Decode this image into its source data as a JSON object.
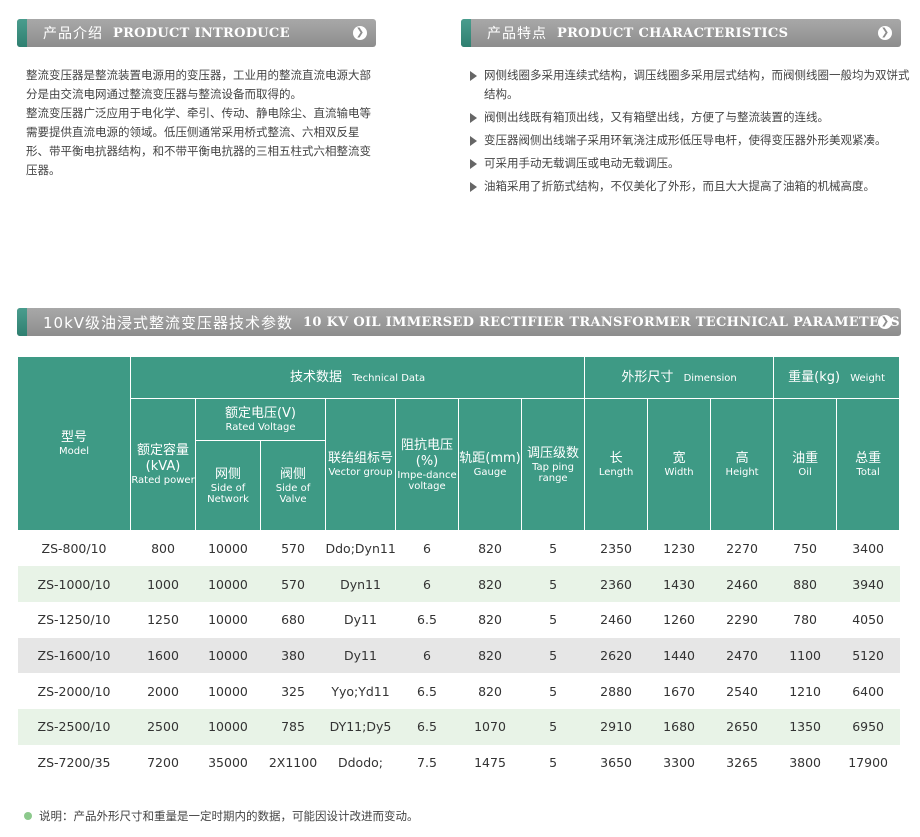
{
  "intro": {
    "header_cn": "产品介绍",
    "header_en": "PRODUCT INTRODUCE",
    "paragraphs": [
      "整流变压器是整流装置电源用的变压器，工业用的整流直流电源大部分是由交流电网通过整流变压器与整流设备而取得的。",
      "整流变压器广泛应用于电化学、牵引、传动、静电除尘、直流输电等需要提供直流电源的领域。低压侧通常采用桥式整流、六相双反星形、带平衡电抗器结构，和不带平衡电抗器的三相五柱式六相整流变压器。"
    ]
  },
  "features": {
    "header_cn": "产品特点",
    "header_en": "PRODUCT CHARACTERISTICS",
    "items": [
      "网侧线圈多采用连续式结构，调压线圈多采用层式结构，而阀侧线圈一般均为双饼式结构。",
      "阀侧出线既有箱顶出线，又有箱壁出线，方便了与整流装置的连线。",
      "变压器阀侧出线端子采用环氧浇注成形低压导电杆，使得变压器外形美观紧凑。",
      "可采用手动无载调压或电动无载调压。",
      "油箱采用了折筋式结构，不仅美化了外形，而且大大提高了油箱的机械高度。"
    ]
  },
  "params": {
    "header_cn": "10kV级油浸式整流变压器技术参数",
    "header_en": "10 KV OIL IMMERSED RECTIFIER TRANSFORMER TECHNICAL PARAMETERS",
    "groups": {
      "model_cn": "型号",
      "model_en": "Model",
      "tech_cn": "技术数据",
      "tech_en": "Technical Data",
      "dim_cn": "外形尺寸",
      "dim_en": "Dimension",
      "weight_cn": "重量(kg)",
      "weight_en": "Weight"
    },
    "columns": {
      "rated_power_cn": "额定容量(kVA)",
      "rated_power_en": "Rated power",
      "rated_voltage_cn": "额定电压(V)",
      "rated_voltage_en": "Rated Voltage",
      "network_cn": "网侧",
      "network_en": "Side of Network",
      "valve_cn": "阀侧",
      "valve_en": "Side of Valve",
      "vector_cn": "联结组标号",
      "vector_en": "Vector group",
      "impedance_cn": "阻抗电压(%)",
      "impedance_en": "Impe-dance voltage",
      "gauge_cn": "轨距(mm)",
      "gauge_en": "Gauge",
      "tap_cn": "调压级数",
      "tap_en": "Tap ping range",
      "length_cn": "长",
      "length_en": "Length",
      "width_cn": "宽",
      "width_en": "Width",
      "height_cn": "高",
      "height_en": "Height",
      "oil_cn": "油重",
      "oil_en": "Oil",
      "total_cn": "总重",
      "total_en": "Total"
    },
    "rows": [
      [
        "ZS-800/10",
        "800",
        "10000",
        "570",
        "Ddo;Dyn11",
        "6",
        "820",
        "5",
        "2350",
        "1230",
        "2270",
        "750",
        "3400"
      ],
      [
        "ZS-1000/10",
        "1000",
        "10000",
        "570",
        "Dyn11",
        "6",
        "820",
        "5",
        "2360",
        "1430",
        "2460",
        "880",
        "3940"
      ],
      [
        "ZS-1250/10",
        "1250",
        "10000",
        "680",
        "Dy11",
        "6.5",
        "820",
        "5",
        "2460",
        "1260",
        "2290",
        "780",
        "4050"
      ],
      [
        "ZS-1600/10",
        "1600",
        "10000",
        "380",
        "Dy11",
        "6",
        "820",
        "5",
        "2620",
        "1440",
        "2470",
        "1100",
        "5120"
      ],
      [
        "ZS-2000/10",
        "2000",
        "10000",
        "325",
        "Yyo;Yd11",
        "6.5",
        "820",
        "5",
        "2880",
        "1670",
        "2540",
        "1210",
        "6400"
      ],
      [
        "ZS-2500/10",
        "2500",
        "10000",
        "785",
        "DY11;Dy5",
        "6.5",
        "1070",
        "5",
        "2910",
        "1680",
        "2650",
        "1350",
        "6950"
      ],
      [
        "ZS-7200/35",
        "7200",
        "35000",
        "2X1100",
        "Ddodo;",
        "7.5",
        "1475",
        "5",
        "3650",
        "3300",
        "3265",
        "3800",
        "17900"
      ]
    ]
  },
  "note": "说明：产品外形尺寸和重量是一定时期内的数据，可能因设计改进而变动。",
  "colors": {
    "accent": "#3e9a85",
    "bar": "#9a9a9a",
    "row_green": "#e8f3e7",
    "row_gray": "#e6e6e6"
  },
  "icons": {
    "header_arrow": "arrow-circle-icon",
    "bullet": "triangle-bullet-icon"
  }
}
